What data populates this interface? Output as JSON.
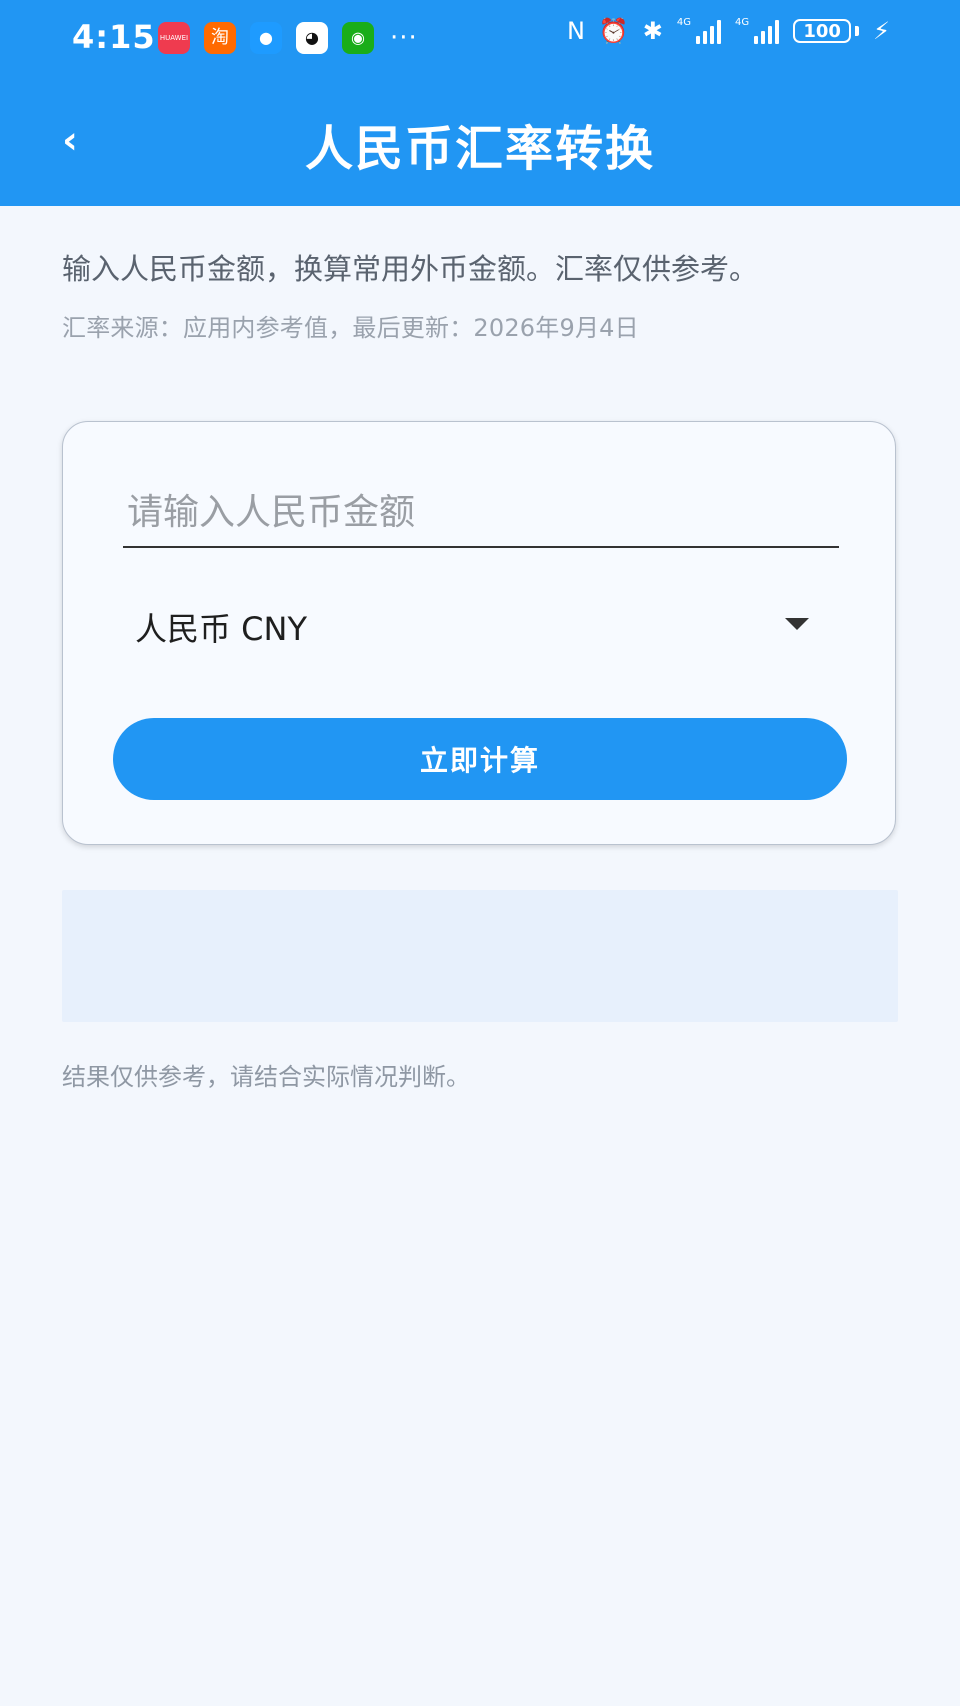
{
  "status_bar": {
    "time": "4:15",
    "app_icons": [
      {
        "name": "huawei-app-icon",
        "glyph": "HUAWEI",
        "color": "#ef3b4f"
      },
      {
        "name": "taobao-app-icon",
        "glyph": "淘",
        "color": "#ff6a00"
      },
      {
        "name": "message-app-icon",
        "glyph": "●",
        "color": "#1e9bff"
      },
      {
        "name": "qq-app-icon",
        "glyph": "◕",
        "color": "#ffffff"
      },
      {
        "name": "wechat-app-icon",
        "glyph": "◉",
        "color": "#1aad19"
      }
    ],
    "more": "···",
    "nfc_icon": "N",
    "alarm_icon": "⏰",
    "bluetooth_icon": "✱",
    "signal_1_label": "4G",
    "signal_2_label": "4G",
    "battery": "100"
  },
  "header": {
    "back_label": "‹",
    "title": "人民币汇率转换",
    "color": "#2196f3"
  },
  "intro": {
    "description": "输入人民币金额，换算常用外币金额。汇率仅供参考。",
    "source": "汇率来源：应用内参考值，最后更新：2026年9月4日"
  },
  "form": {
    "amount_placeholder": "请输入人民币金额",
    "amount_value": "",
    "currency_selected": "人民币 CNY",
    "calculate_label": "立即计算"
  },
  "footer": {
    "note": "结果仅供参考，请结合实际情况判断。"
  }
}
